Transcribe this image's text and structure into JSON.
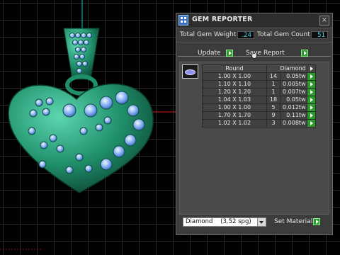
{
  "window": {
    "title": "GEM REPORTER",
    "close": "×"
  },
  "summary": {
    "weight_label": "Total Gem Weight",
    "weight_value": ".24",
    "count_label": "Total Gem Count",
    "count_value": "51"
  },
  "actions": {
    "update": "Update",
    "save_report": "Save Report"
  },
  "table": {
    "headers": [
      "Round",
      "",
      "Diamond",
      ""
    ],
    "rows": [
      {
        "size": "1.00 X 1.00",
        "count": "14",
        "weight": "0.05tw"
      },
      {
        "size": "1.10 X 1.10",
        "count": "1",
        "weight": "0.005tw"
      },
      {
        "size": "1.20 X 1.20",
        "count": "1",
        "weight": "0.007tw"
      },
      {
        "size": "1.04 X 1.03",
        "count": "18",
        "weight": "0.05tw"
      },
      {
        "size": "1.00 X 1.00",
        "count": "5",
        "weight": "0.012tw"
      },
      {
        "size": "1.70 X 1.70",
        "count": "9",
        "weight": "0.11tw"
      },
      {
        "size": "1.02 X 1.02",
        "count": "3",
        "weight": "0.008tw"
      }
    ]
  },
  "material": {
    "selected": "Diamond    (3.52 spg)",
    "set_label": "Set Material"
  },
  "colors": {
    "accent_value": "#47d6e8",
    "play_green": "#2c9a2c",
    "gem_blue": "#7aa8f0",
    "metal_green": "#1f8f6a"
  },
  "icons": {
    "app": "gem-reporter-app-icon",
    "gem": "round-gem-icon",
    "play": "play-arrow-icon"
  }
}
